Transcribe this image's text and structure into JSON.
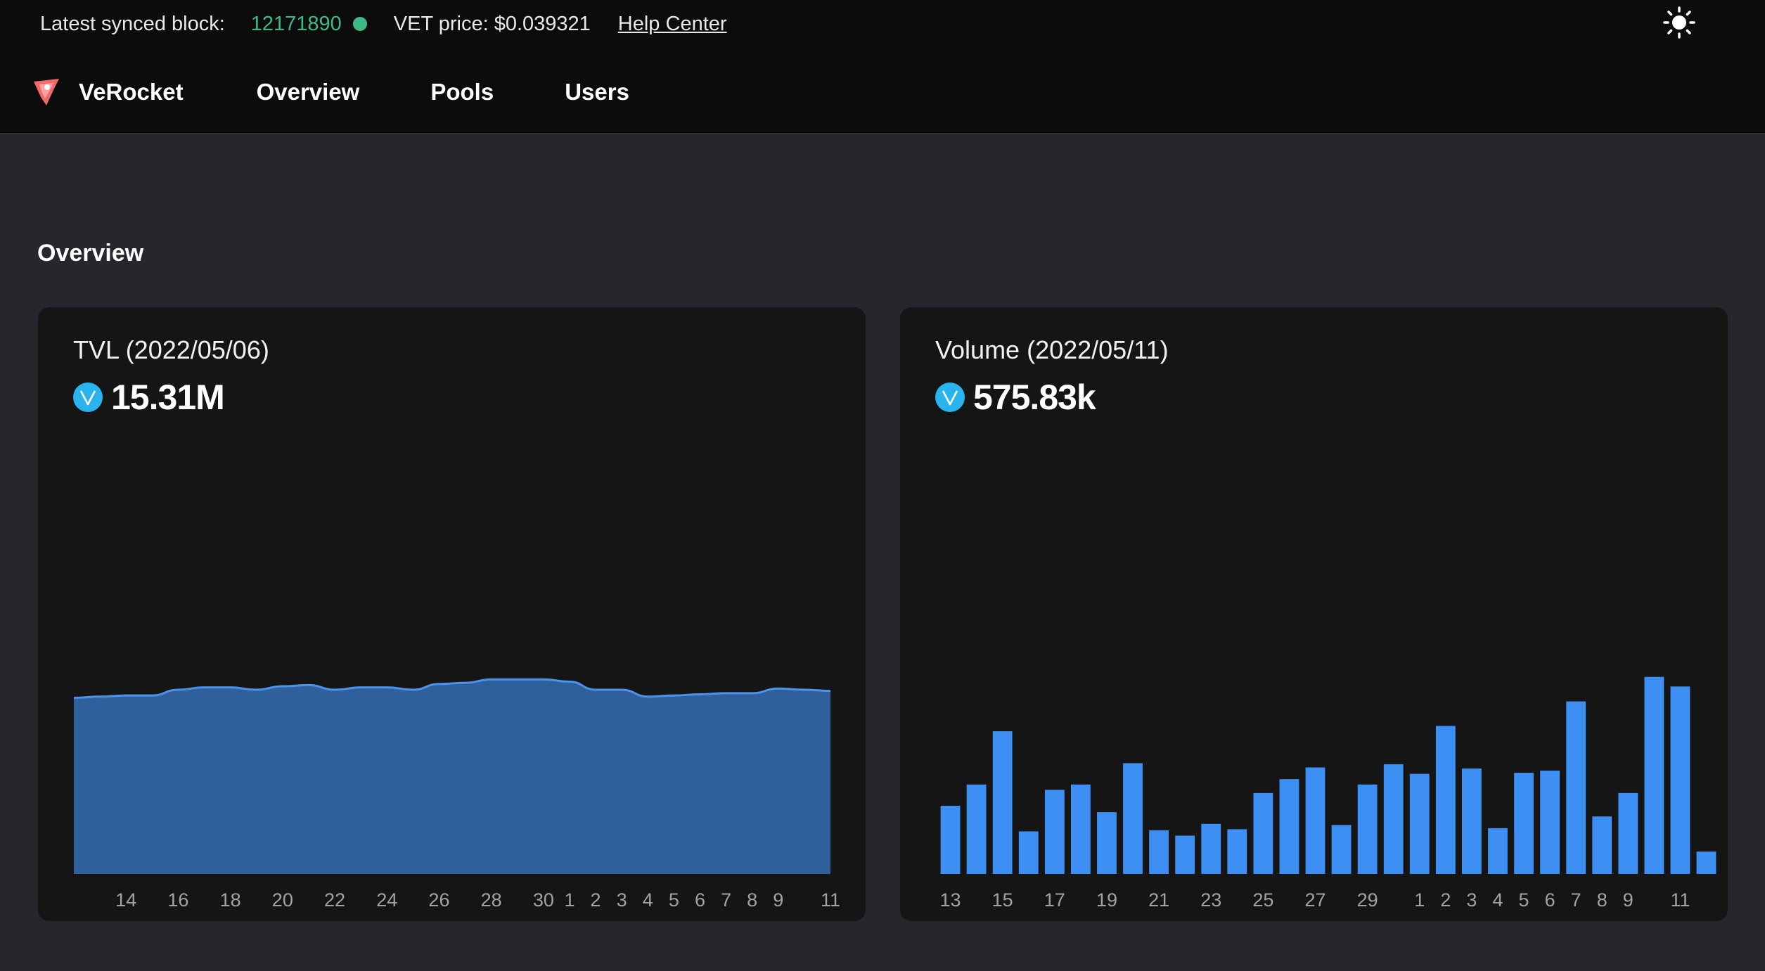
{
  "status": {
    "block_label": "Latest synced block:",
    "block_value": "12171890",
    "price_text": "VET price: $0.039321",
    "help_label": "Help Center"
  },
  "nav": {
    "brand": "VeRocket",
    "items": [
      "Overview",
      "Pools",
      "Users"
    ]
  },
  "page": {
    "section_title": "Overview"
  },
  "colors": {
    "accent_green": "#3dba83",
    "area_fill": "#2f609b",
    "area_line": "#4b93ec",
    "bar": "#3d8ff4",
    "vet_blue": "#29b3ef"
  },
  "icons": {
    "theme_toggle": "sun-icon",
    "vet_token": "vet-token-icon",
    "logo": "verocket-logo-icon"
  },
  "tvl": {
    "title": "TVL (2022/05/06)",
    "value": "15.31M"
  },
  "volume": {
    "title": "Volume (2022/05/11)",
    "value": "575.83k"
  },
  "chart_data": [
    {
      "type": "area",
      "name": "TVL",
      "x": [
        "2022-04-12",
        "2022-04-13",
        "2022-04-14",
        "2022-04-15",
        "2022-04-16",
        "2022-04-17",
        "2022-04-18",
        "2022-04-19",
        "2022-04-20",
        "2022-04-21",
        "2022-04-22",
        "2022-04-23",
        "2022-04-24",
        "2022-04-25",
        "2022-04-26",
        "2022-04-27",
        "2022-04-28",
        "2022-04-29",
        "2022-04-30",
        "2022-05-01",
        "2022-05-02",
        "2022-05-03",
        "2022-05-04",
        "2022-05-05",
        "2022-05-06",
        "2022-05-07",
        "2022-05-08",
        "2022-05-09",
        "2022-05-10",
        "2022-05-11"
      ],
      "values": [
        15.3,
        15.4,
        15.5,
        15.5,
        16.0,
        16.2,
        16.2,
        16.0,
        16.3,
        16.4,
        16.0,
        16.2,
        16.2,
        16.0,
        16.5,
        16.6,
        16.9,
        16.9,
        16.9,
        16.7,
        16.0,
        16.0,
        15.4,
        15.5,
        15.6,
        15.7,
        15.7,
        16.1,
        16.0,
        15.9
      ],
      "x_tick_labels": [
        "14",
        "16",
        "18",
        "20",
        "22",
        "24",
        "26",
        "28",
        "30",
        "1",
        "2",
        "3",
        "4",
        "5",
        "6",
        "7",
        "8",
        "9",
        "11"
      ],
      "x_tick_dates": [
        "2022-04-14",
        "2022-04-16",
        "2022-04-18",
        "2022-04-20",
        "2022-04-22",
        "2022-04-24",
        "2022-04-26",
        "2022-04-28",
        "2022-04-30",
        "2022-05-01",
        "2022-05-02",
        "2022-05-03",
        "2022-05-04",
        "2022-05-05",
        "2022-05-06",
        "2022-05-07",
        "2022-05-08",
        "2022-05-09",
        "2022-05-11"
      ],
      "ylim": [
        0,
        37
      ],
      "grid": false,
      "legend": "none"
    },
    {
      "type": "bar",
      "name": "Volume",
      "categories": [
        "13",
        "14",
        "15",
        "16",
        "17",
        "18",
        "19",
        "20",
        "21",
        "22",
        "23",
        "24",
        "25",
        "26",
        "27",
        "28",
        "29",
        "30",
        "1",
        "2",
        "3",
        "4",
        "5",
        "6",
        "7",
        "8",
        "9",
        "10",
        "11"
      ],
      "values": [
        320,
        420,
        670,
        200,
        395,
        420,
        290,
        520,
        205,
        180,
        235,
        210,
        380,
        445,
        500,
        230,
        420,
        515,
        470,
        695,
        495,
        215,
        475,
        485,
        810,
        270,
        380,
        925,
        880,
        105
      ],
      "x_tick_labels": [
        "13",
        "15",
        "17",
        "19",
        "21",
        "23",
        "25",
        "27",
        "29",
        "1",
        "2",
        "3",
        "4",
        "5",
        "6",
        "7",
        "8",
        "9",
        "11"
      ],
      "ylim": [
        0,
        2000
      ],
      "grid": false,
      "legend": "none"
    }
  ]
}
